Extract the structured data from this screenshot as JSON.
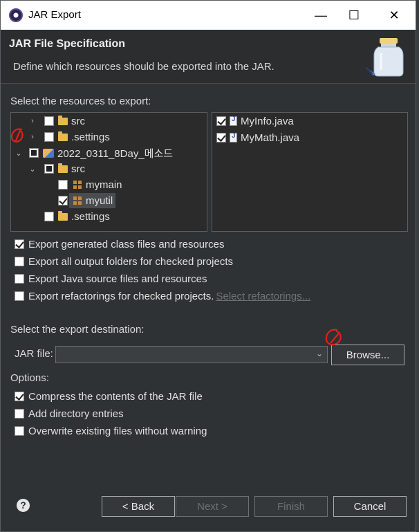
{
  "window": {
    "title": "JAR Export",
    "controls": {
      "minimize": "—",
      "maximize": "☐",
      "close": "✕"
    }
  },
  "banner": {
    "heading": "JAR File Specification",
    "description": "Define which resources should be exported into the JAR."
  },
  "resources": {
    "label": "Select the resources to export:",
    "tree": [
      {
        "label": "src",
        "expanded": false,
        "checked": false,
        "icon": "folder-icon"
      },
      {
        "label": ".settings",
        "expanded": false,
        "checked": false,
        "icon": "folder-icon"
      },
      {
        "label": "2022_0311_8Day_메소드",
        "expanded": true,
        "state": "partial",
        "icon": "project-icon"
      },
      {
        "label": "src",
        "expanded": true,
        "state": "partial",
        "icon": "folder-icon"
      },
      {
        "label": "mymain",
        "checked": false,
        "icon": "package-icon"
      },
      {
        "label": "myutil",
        "checked": true,
        "selected": true,
        "icon": "package-icon"
      },
      {
        "label": ".settings",
        "checked": false,
        "icon": "folder-icon"
      }
    ],
    "files": [
      {
        "label": "MyInfo.java",
        "checked": true,
        "icon": "java-file-icon"
      },
      {
        "label": "MyMath.java",
        "checked": true,
        "icon": "java-file-icon"
      }
    ]
  },
  "export_options": [
    {
      "label": "Export generated class files and resources",
      "checked": true
    },
    {
      "label": "Export all output folders for checked projects",
      "checked": false
    },
    {
      "label": "Export Java source files and resources",
      "checked": false
    },
    {
      "label": "Export refactorings for checked projects.",
      "checked": false,
      "link": "Select refactorings..."
    }
  ],
  "destination": {
    "label": "Select the export destination:",
    "jar_label": "JAR file:",
    "jar_value": "",
    "browse": "Browse..."
  },
  "options": {
    "label": "Options:",
    "items": [
      {
        "label": "Compress the contents of the JAR file",
        "checked": true
      },
      {
        "label": "Add directory entries",
        "checked": false
      },
      {
        "label": "Overwrite existing files without warning",
        "checked": false
      }
    ]
  },
  "footer": {
    "help": "?",
    "back": "< Back",
    "next": "Next >",
    "finish": "Finish",
    "cancel": "Cancel"
  },
  "colors": {
    "dialog_bg": "#2f3234",
    "annotation": "#e0201c"
  }
}
